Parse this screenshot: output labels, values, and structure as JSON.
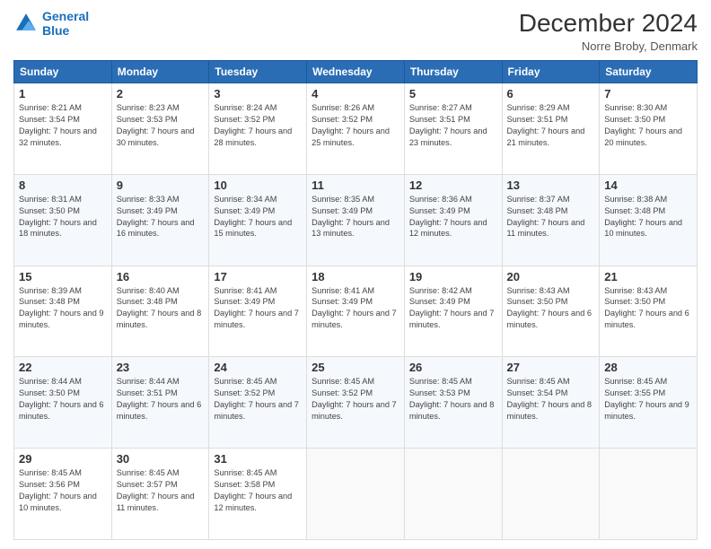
{
  "header": {
    "logo_line1": "General",
    "logo_line2": "Blue",
    "title": "December 2024",
    "location": "Norre Broby, Denmark"
  },
  "days_of_week": [
    "Sunday",
    "Monday",
    "Tuesday",
    "Wednesday",
    "Thursday",
    "Friday",
    "Saturday"
  ],
  "weeks": [
    [
      {
        "day": "1",
        "rise": "Sunrise: 8:21 AM",
        "set": "Sunset: 3:54 PM",
        "daylight": "Daylight: 7 hours and 32 minutes."
      },
      {
        "day": "2",
        "rise": "Sunrise: 8:23 AM",
        "set": "Sunset: 3:53 PM",
        "daylight": "Daylight: 7 hours and 30 minutes."
      },
      {
        "day": "3",
        "rise": "Sunrise: 8:24 AM",
        "set": "Sunset: 3:52 PM",
        "daylight": "Daylight: 7 hours and 28 minutes."
      },
      {
        "day": "4",
        "rise": "Sunrise: 8:26 AM",
        "set": "Sunset: 3:52 PM",
        "daylight": "Daylight: 7 hours and 25 minutes."
      },
      {
        "day": "5",
        "rise": "Sunrise: 8:27 AM",
        "set": "Sunset: 3:51 PM",
        "daylight": "Daylight: 7 hours and 23 minutes."
      },
      {
        "day": "6",
        "rise": "Sunrise: 8:29 AM",
        "set": "Sunset: 3:51 PM",
        "daylight": "Daylight: 7 hours and 21 minutes."
      },
      {
        "day": "7",
        "rise": "Sunrise: 8:30 AM",
        "set": "Sunset: 3:50 PM",
        "daylight": "Daylight: 7 hours and 20 minutes."
      }
    ],
    [
      {
        "day": "8",
        "rise": "Sunrise: 8:31 AM",
        "set": "Sunset: 3:50 PM",
        "daylight": "Daylight: 7 hours and 18 minutes."
      },
      {
        "day": "9",
        "rise": "Sunrise: 8:33 AM",
        "set": "Sunset: 3:49 PM",
        "daylight": "Daylight: 7 hours and 16 minutes."
      },
      {
        "day": "10",
        "rise": "Sunrise: 8:34 AM",
        "set": "Sunset: 3:49 PM",
        "daylight": "Daylight: 7 hours and 15 minutes."
      },
      {
        "day": "11",
        "rise": "Sunrise: 8:35 AM",
        "set": "Sunset: 3:49 PM",
        "daylight": "Daylight: 7 hours and 13 minutes."
      },
      {
        "day": "12",
        "rise": "Sunrise: 8:36 AM",
        "set": "Sunset: 3:49 PM",
        "daylight": "Daylight: 7 hours and 12 minutes."
      },
      {
        "day": "13",
        "rise": "Sunrise: 8:37 AM",
        "set": "Sunset: 3:48 PM",
        "daylight": "Daylight: 7 hours and 11 minutes."
      },
      {
        "day": "14",
        "rise": "Sunrise: 8:38 AM",
        "set": "Sunset: 3:48 PM",
        "daylight": "Daylight: 7 hours and 10 minutes."
      }
    ],
    [
      {
        "day": "15",
        "rise": "Sunrise: 8:39 AM",
        "set": "Sunset: 3:48 PM",
        "daylight": "Daylight: 7 hours and 9 minutes."
      },
      {
        "day": "16",
        "rise": "Sunrise: 8:40 AM",
        "set": "Sunset: 3:48 PM",
        "daylight": "Daylight: 7 hours and 8 minutes."
      },
      {
        "day": "17",
        "rise": "Sunrise: 8:41 AM",
        "set": "Sunset: 3:49 PM",
        "daylight": "Daylight: 7 hours and 7 minutes."
      },
      {
        "day": "18",
        "rise": "Sunrise: 8:41 AM",
        "set": "Sunset: 3:49 PM",
        "daylight": "Daylight: 7 hours and 7 minutes."
      },
      {
        "day": "19",
        "rise": "Sunrise: 8:42 AM",
        "set": "Sunset: 3:49 PM",
        "daylight": "Daylight: 7 hours and 7 minutes."
      },
      {
        "day": "20",
        "rise": "Sunrise: 8:43 AM",
        "set": "Sunset: 3:50 PM",
        "daylight": "Daylight: 7 hours and 6 minutes."
      },
      {
        "day": "21",
        "rise": "Sunrise: 8:43 AM",
        "set": "Sunset: 3:50 PM",
        "daylight": "Daylight: 7 hours and 6 minutes."
      }
    ],
    [
      {
        "day": "22",
        "rise": "Sunrise: 8:44 AM",
        "set": "Sunset: 3:50 PM",
        "daylight": "Daylight: 7 hours and 6 minutes."
      },
      {
        "day": "23",
        "rise": "Sunrise: 8:44 AM",
        "set": "Sunset: 3:51 PM",
        "daylight": "Daylight: 7 hours and 6 minutes."
      },
      {
        "day": "24",
        "rise": "Sunrise: 8:45 AM",
        "set": "Sunset: 3:52 PM",
        "daylight": "Daylight: 7 hours and 7 minutes."
      },
      {
        "day": "25",
        "rise": "Sunrise: 8:45 AM",
        "set": "Sunset: 3:52 PM",
        "daylight": "Daylight: 7 hours and 7 minutes."
      },
      {
        "day": "26",
        "rise": "Sunrise: 8:45 AM",
        "set": "Sunset: 3:53 PM",
        "daylight": "Daylight: 7 hours and 8 minutes."
      },
      {
        "day": "27",
        "rise": "Sunrise: 8:45 AM",
        "set": "Sunset: 3:54 PM",
        "daylight": "Daylight: 7 hours and 8 minutes."
      },
      {
        "day": "28",
        "rise": "Sunrise: 8:45 AM",
        "set": "Sunset: 3:55 PM",
        "daylight": "Daylight: 7 hours and 9 minutes."
      }
    ],
    [
      {
        "day": "29",
        "rise": "Sunrise: 8:45 AM",
        "set": "Sunset: 3:56 PM",
        "daylight": "Daylight: 7 hours and 10 minutes."
      },
      {
        "day": "30",
        "rise": "Sunrise: 8:45 AM",
        "set": "Sunset: 3:57 PM",
        "daylight": "Daylight: 7 hours and 11 minutes."
      },
      {
        "day": "31",
        "rise": "Sunrise: 8:45 AM",
        "set": "Sunset: 3:58 PM",
        "daylight": "Daylight: 7 hours and 12 minutes."
      },
      null,
      null,
      null,
      null
    ]
  ]
}
